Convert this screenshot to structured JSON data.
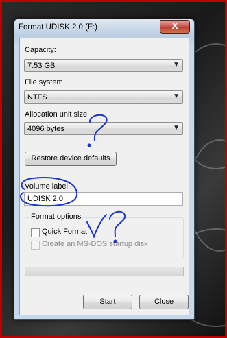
{
  "window": {
    "title": "Format UDISK 2.0 (F:)",
    "close_label": "X"
  },
  "capacity": {
    "label": "Capacity:",
    "value": "7.53 GB"
  },
  "file_system": {
    "label": "File system",
    "value": "NTFS"
  },
  "allocation": {
    "label": "Allocation unit size",
    "value": "4096 bytes"
  },
  "restore_button": "Restore device defaults",
  "volume": {
    "label": "Volume label",
    "value": "UDISK 2.0"
  },
  "format_options": {
    "label": "Format options",
    "quick_format": {
      "label": "Quick Format",
      "checked": false,
      "enabled": true
    },
    "msdos": {
      "label": "Create an MS-DOS startup disk",
      "checked": false,
      "enabled": false
    }
  },
  "progress": {
    "fraction": 0
  },
  "buttons": {
    "start": "Start",
    "close": "Close"
  },
  "colors": {
    "ink": "#1a33c8",
    "border": "#c00000"
  },
  "icons": {
    "dropdown": "chevron-down-icon",
    "close": "close-icon"
  }
}
